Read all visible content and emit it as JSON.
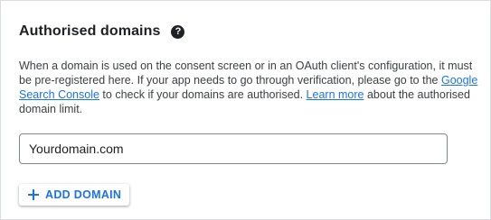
{
  "section": {
    "title": "Authorised domains",
    "help_icon": "help-circle-icon",
    "description": {
      "text_1": "When a domain is used on the consent screen or in an OAuth client's configuration, it must be pre-registered here. If your app needs to go through verification, please go to the ",
      "link_search_console": "Google Search Console",
      "text_2": " to check if your domains are authorised. ",
      "link_learn_more": "Learn more",
      "text_3": " about the authorised domain limit."
    }
  },
  "domain_input": {
    "value": "Yourdomain.com",
    "placeholder": ""
  },
  "add_button": {
    "icon": "plus-icon",
    "label": "ADD DOMAIN"
  },
  "colors": {
    "accent": "#1a73e8",
    "text": "#202124",
    "muted_text": "#3c4043",
    "border": "#dadce0"
  }
}
